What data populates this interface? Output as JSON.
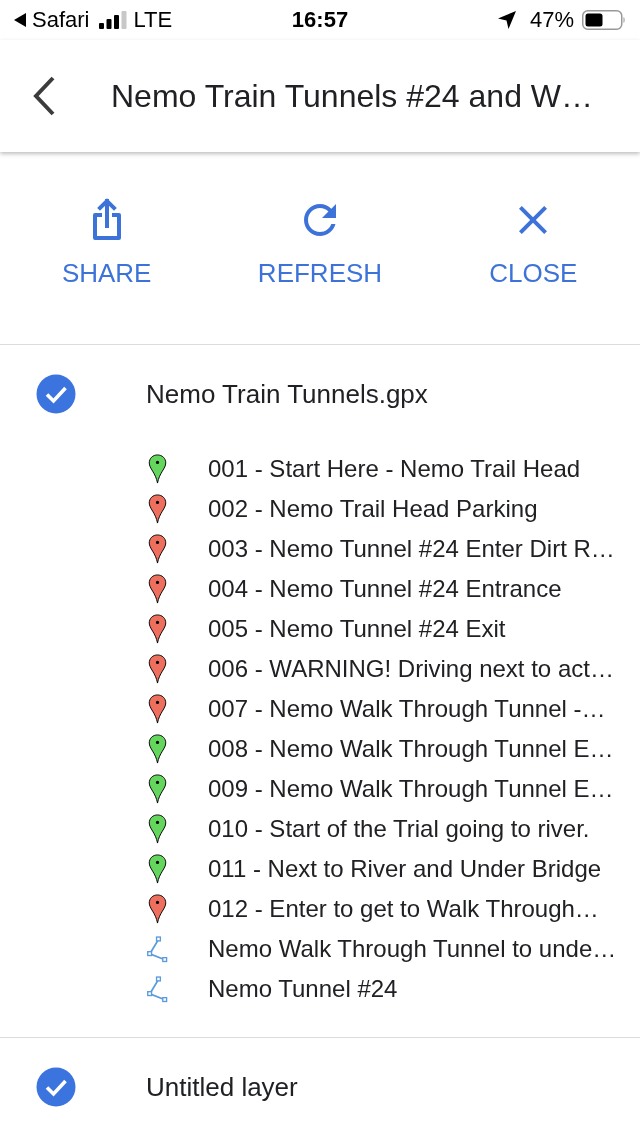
{
  "status_bar": {
    "back_label": "Safari",
    "network": "LTE",
    "time": "16:57",
    "battery": "47%"
  },
  "header": {
    "title": "Nemo Train Tunnels #24 and W…"
  },
  "actions": [
    {
      "kind": "share",
      "label": "SHARE"
    },
    {
      "kind": "refresh",
      "label": "REFRESH"
    },
    {
      "kind": "close",
      "label": "CLOSE"
    }
  ],
  "layers": [
    {
      "name": "Nemo Train Tunnels.gpx",
      "checked": true,
      "items": [
        {
          "kind": "placemark",
          "label": "001 - Start Here - Nemo Trail Head",
          "color": "#65d65d"
        },
        {
          "kind": "placemark",
          "label": "002 - Nemo Trail Head Parking",
          "color": "#ee6f5e"
        },
        {
          "kind": "placemark",
          "label": "003 - Nemo Tunnel #24 Enter Dirt R…",
          "color": "#ee6f5e"
        },
        {
          "kind": "placemark",
          "label": "004 - Nemo Tunnel #24 Entrance",
          "color": "#ee6f5e"
        },
        {
          "kind": "placemark",
          "label": "005 - Nemo Tunnel #24 Exit",
          "color": "#ee6f5e"
        },
        {
          "kind": "placemark",
          "label": "006 - WARNING! Driving next to act…",
          "color": "#ee6f5e"
        },
        {
          "kind": "placemark",
          "label": "007 - Nemo Walk Through Tunnel -…",
          "color": "#ee6f5e"
        },
        {
          "kind": "placemark",
          "label": "008 - Nemo Walk Through Tunnel E…",
          "color": "#65d65d"
        },
        {
          "kind": "placemark",
          "label": "009 - Nemo Walk Through Tunnel E…",
          "color": "#65d65d"
        },
        {
          "kind": "placemark",
          "label": "010 - Start of the Trial going to river.",
          "color": "#65d65d"
        },
        {
          "kind": "placemark",
          "label": "011 - Next to River and Under Bridge",
          "color": "#65d65d"
        },
        {
          "kind": "placemark",
          "label": "012 - Enter to get to Walk Through…",
          "color": "#ee6f5e"
        },
        {
          "kind": "path",
          "label": "Nemo Walk Through Tunnel to unde…",
          "color": "#5b9bdc"
        },
        {
          "kind": "path",
          "label": "Nemo Tunnel #24",
          "color": "#5b9bdc"
        }
      ]
    },
    {
      "name": "Untitled layer",
      "checked": true
    }
  ]
}
